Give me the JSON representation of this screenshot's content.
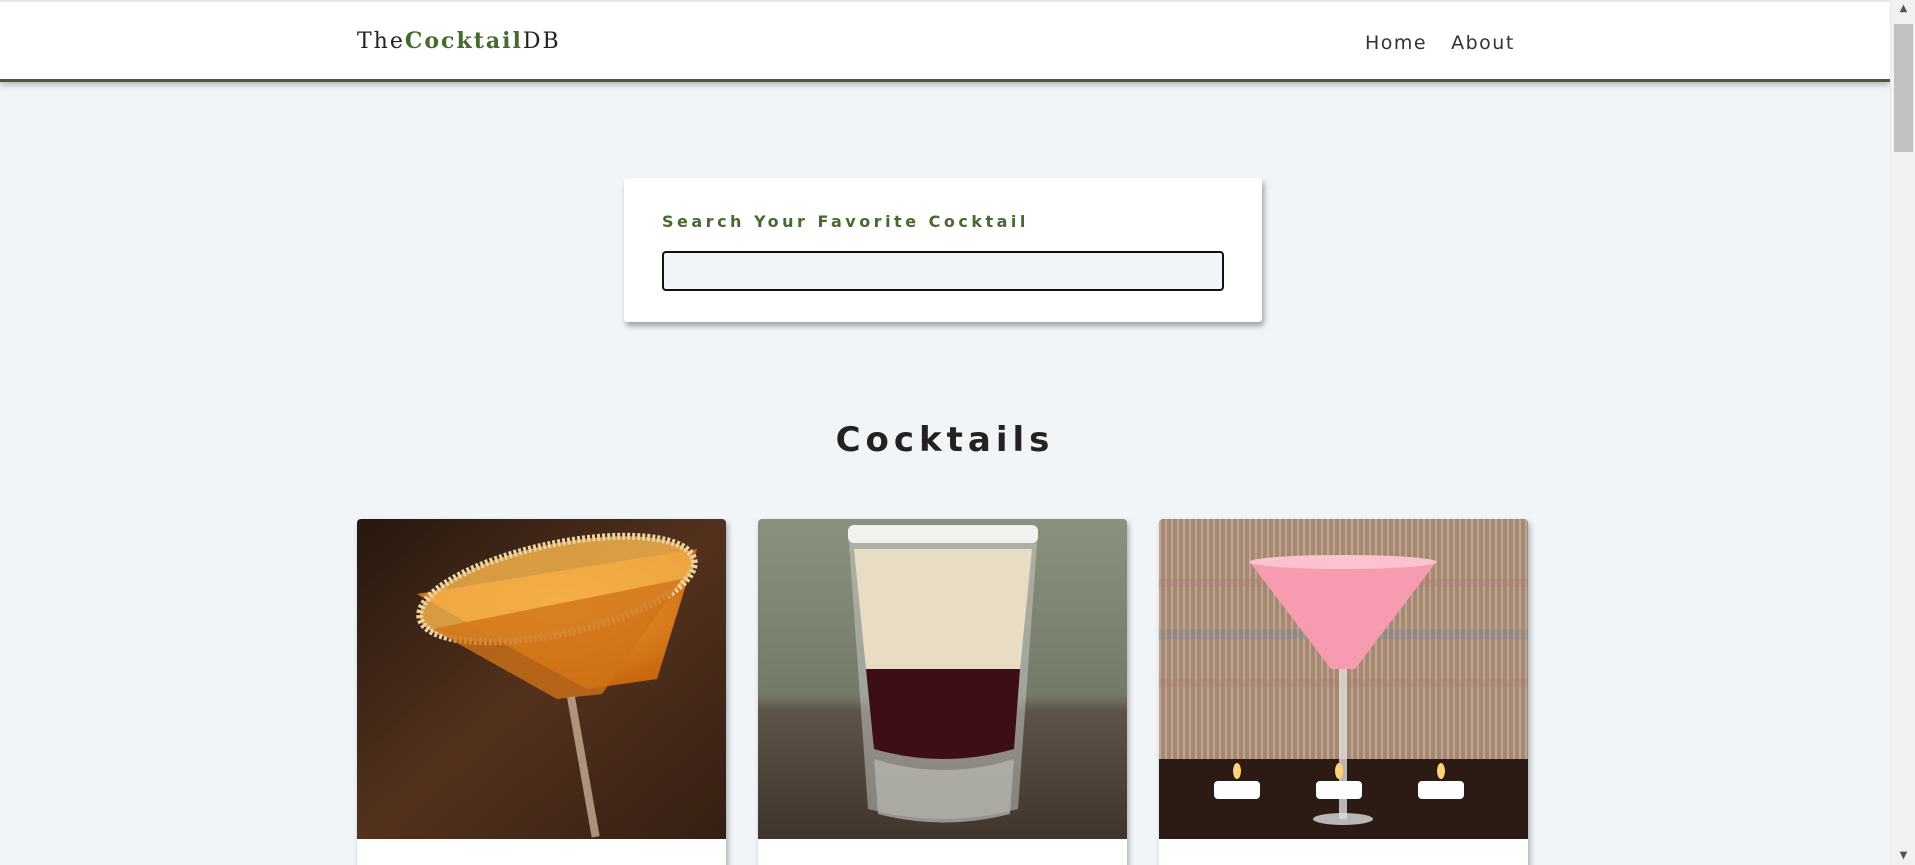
{
  "brand": {
    "prefix": "The",
    "accent": "Cocktail",
    "suffix": "DB"
  },
  "nav": {
    "home_label": "Home",
    "about_label": "About"
  },
  "search": {
    "label": "Search Your Favorite Cocktail",
    "value": "",
    "placeholder": ""
  },
  "section": {
    "title": "Cocktails"
  },
  "cocktails": [
    {
      "image": "orange-martini-sugar-rim"
    },
    {
      "image": "layered-shot-glass"
    },
    {
      "image": "pink-martini-candles"
    }
  ],
  "colors": {
    "accent": "#476a2e",
    "background": "#f1f5f8",
    "nav_border": "#4a5b3d"
  }
}
